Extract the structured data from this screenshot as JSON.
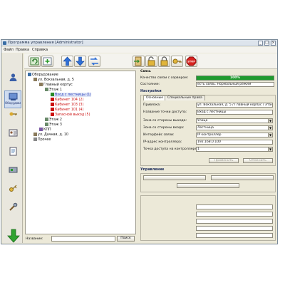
{
  "window": {
    "title": "Программа управления [Administrator]",
    "minimize_label": "_",
    "maximize_label": "□",
    "close_label": "×"
  },
  "menu": {
    "file": "Файл",
    "edit": "Правка",
    "help": "Справка"
  },
  "toolbar": {
    "stop_label": "STOP"
  },
  "sidebar": {
    "items": [
      {
        "label": "",
        "icon": "user-icon"
      },
      {
        "label": "Оборудование",
        "icon": "equipment-icon"
      },
      {
        "label": "",
        "icon": "keys-icon"
      },
      {
        "label": "",
        "icon": "id-card-icon"
      },
      {
        "label": "",
        "icon": "reports-icon"
      },
      {
        "label": "",
        "icon": "hardware-icon"
      },
      {
        "label": "",
        "icon": "key-icon"
      },
      {
        "label": "",
        "icon": "tools-icon"
      }
    ],
    "bottom_label": ""
  },
  "tree": {
    "nodes": [
      {
        "label": "Оборудование",
        "level": 0,
        "icon": "root-icon",
        "color": "#111111"
      },
      {
        "label": "ул. Вокзальная, д. 5",
        "level": 1,
        "icon": "building-icon",
        "color": "#111111"
      },
      {
        "label": "Главный корпус",
        "level": 2,
        "icon": "building-icon",
        "color": "#111111"
      },
      {
        "label": "Этаж 1",
        "level": 3,
        "icon": "floor-icon",
        "color": "#111111"
      },
      {
        "label": "Вход с лестницы (1)",
        "level": 4,
        "icon": "door-icon",
        "color": "#2a3dbd"
      },
      {
        "label": "Кабинет 104 (2)",
        "level": 4,
        "icon": "door-alarm-icon",
        "color": "#cc1111"
      },
      {
        "label": "Кабинет 103 (3)",
        "level": 4,
        "icon": "door-alarm-icon",
        "color": "#cc1111"
      },
      {
        "label": "Кабинет 101 (4)",
        "level": 4,
        "icon": "door-alarm-icon",
        "color": "#cc1111"
      },
      {
        "label": "Запасной выход (5)",
        "level": 4,
        "icon": "door-alarm-icon",
        "color": "#cc1111"
      },
      {
        "label": "Этаж 2",
        "level": 3,
        "icon": "floor-icon",
        "color": "#111111"
      },
      {
        "label": "Этаж 3",
        "level": 3,
        "icon": "floor-icon",
        "color": "#111111"
      },
      {
        "label": "КПП",
        "level": 2,
        "icon": "gate-icon",
        "color": "#111111"
      },
      {
        "label": "ул. Дачная, д. 10",
        "level": 1,
        "icon": "building-icon",
        "color": "#111111"
      },
      {
        "label": "Прочее",
        "level": 1,
        "icon": "misc-icon",
        "color": "#111111"
      }
    ]
  },
  "search": {
    "label": "Название:",
    "value": "",
    "button": "Поиск"
  },
  "status_panel": {
    "title": "Связь",
    "quality_label": "Качество связи с сервером:",
    "quality_value": "100%",
    "quality_fraction": 1.0,
    "state_label": "Состояние:",
    "state_value": "есть связь. Нормальный режим"
  },
  "settings": {
    "title": "Настройки",
    "tabs": [
      "Основные",
      "Специальные права"
    ],
    "rows": [
      {
        "label": "Привязка:",
        "value": "ул. Вокзальная, д. 5 / Главный корпус / Этаж 1"
      },
      {
        "label": "Название точки доступа:",
        "value": "Вход с лестницы"
      },
      {
        "label": "Зона со стороны выхода:",
        "value": "Улица"
      },
      {
        "label": "Зона со стороны входа:",
        "value": "Лестница"
      },
      {
        "label": "Интерфейс связи:",
        "value": "IP контроллер"
      },
      {
        "label": "IP-адрес контроллера:",
        "value": "192.168.0.100"
      },
      {
        "label": "Точка доступа на контроллере:",
        "value": "1"
      }
    ],
    "apply_button": "Применить",
    "cancel_button": "Отменить"
  },
  "control": {
    "title": "Управление",
    "button_1": "",
    "button_2": "",
    "button_3": ""
  },
  "controller_state": {
    "title": "",
    "rows": [
      {
        "label": "",
        "value": ""
      },
      {
        "label": "",
        "value": ""
      },
      {
        "label": "",
        "value": ""
      },
      {
        "label": "",
        "value": ""
      },
      {
        "label": "",
        "value": ""
      }
    ]
  }
}
